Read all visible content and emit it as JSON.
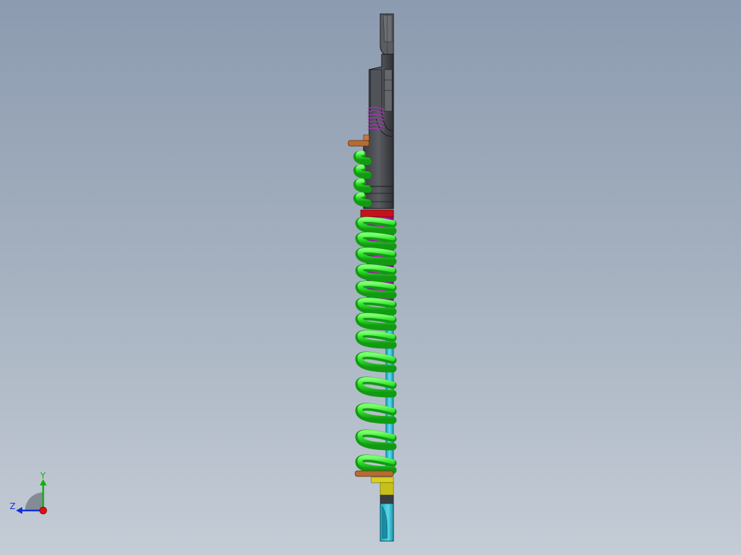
{
  "viewport": {
    "model": "coil-over-shock-absorber",
    "view": "right-side-section",
    "colors": {
      "background_top": "#8c9bb0",
      "background_bottom": "#c4ccd6",
      "spring": "#2ee02a",
      "spring_shadow": "#18a818",
      "body": "#4a4d52",
      "boot": "#b000b8",
      "shaft": "#2fc8e0",
      "seal_ring": "#c8101a",
      "collar": "#b86a30",
      "yellow_bushing": "#d8d020",
      "inner_spring": "#b030c0"
    }
  },
  "triad": {
    "x_label": "",
    "y_label": "Y",
    "z_label": "Z",
    "colors": {
      "y": "#10b010",
      "z": "#1030d8",
      "origin": "#e01010"
    }
  }
}
